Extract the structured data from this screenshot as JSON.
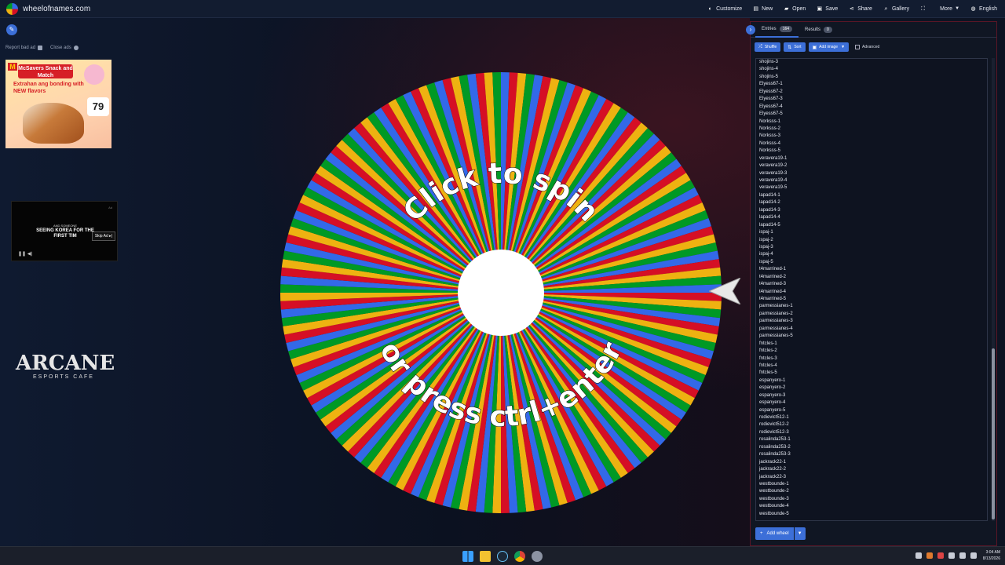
{
  "browser": {
    "site_title": "wheelofnames.com",
    "nav": [
      {
        "label": "Customize",
        "icon": "palette-icon"
      },
      {
        "label": "New",
        "icon": "new-file-icon"
      },
      {
        "label": "Open",
        "icon": "folder-icon"
      },
      {
        "label": "Save",
        "icon": "save-icon"
      },
      {
        "label": "Share",
        "icon": "share-icon"
      },
      {
        "label": "Gallery",
        "icon": "search-icon"
      },
      {
        "label": "",
        "icon": "fullscreen-icon"
      },
      {
        "label": "More",
        "icon": "more-icon"
      },
      {
        "label": "English",
        "icon": "globe-icon"
      }
    ]
  },
  "ads": {
    "report_label": "Report bad ad",
    "close_label": "Close ads",
    "ad1": {
      "brand": "McSavers Snack and Match",
      "tagline": "Extrahan ang bonding with NEW flavors",
      "price": "79"
    },
    "ad2": {
      "small": "AND SOMEONE",
      "headline": "SEEING KOREA FOR THE FIRST TIM",
      "skip": "Skip Ad",
      "badge": "Ad"
    },
    "arcane": {
      "big": "ARCANE",
      "small": "ESPORTS CAFE"
    }
  },
  "wheel": {
    "text_top": "Click to spin",
    "text_bottom": "or press ctrl+enter",
    "colors": [
      "#3369e8",
      "#d50f25",
      "#eeb211",
      "#009925"
    ]
  },
  "panel": {
    "tab_entries": "Entries",
    "entries_count": "164",
    "tab_results": "Results",
    "results_count": "0",
    "shuffle": "Shuffle",
    "sort": "Sort",
    "add_image": "Add image",
    "advanced": "Advanced",
    "add_wheel": "Add wheel",
    "entries": [
      "shojins-3",
      "shojins-4",
      "shojins-5",
      "Elyess67-1",
      "Elyess67-2",
      "Elyess67-3",
      "Elyess67-4",
      "Elyess67-5",
      "Norksss-1",
      "Norksss-2",
      "Norksss-3",
      "Norksss-4",
      "Norksss-5",
      "veravera19-1",
      "veravera19-2",
      "veravera19-3",
      "veravera19-4",
      "veravera19-5",
      "lapad14-1",
      "lapad14-2",
      "lapad14-3",
      "lapad14-4",
      "lapad14-5",
      "ispaj-1",
      "ispaj-2",
      "ispaj-3",
      "ispaj-4",
      "ispaj-5",
      "t4marrined-1",
      "t4marrined-2",
      "t4marrined-3",
      "t4marrined-4",
      "t4marrined-5",
      "parmessianes-1",
      "parmessianes-2",
      "parmessianes-3",
      "parmessianes-4",
      "parmessianes-5",
      "fntcles-1",
      "fntcles-2",
      "fntcles-3",
      "fntcles-4",
      "fntcles-5",
      "espanyero-1",
      "espanyero-2",
      "espanyero-3",
      "espanyero-4",
      "espanyero-5",
      "rodievict512-1",
      "rodievict512-2",
      "rodievict512-3",
      "rosalinda253-1",
      "rosalinda253-2",
      "rosalinda253-3",
      "jackrack22-1",
      "jackrack22-2",
      "jackrack22-3",
      "westbounde-1",
      "westbounde-2",
      "westbounde-3",
      "westbounde-4",
      "westbounde-5"
    ]
  },
  "taskbar": {
    "time": "3:04 AM",
    "date": "8/13/2026"
  }
}
